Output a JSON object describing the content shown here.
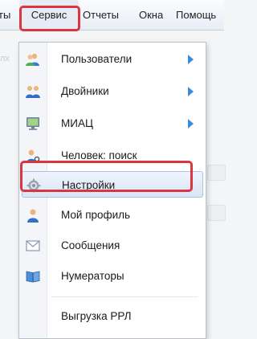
{
  "menubar": {
    "prev_cut": "ты",
    "service": "Сервис",
    "reports": "Отчеты",
    "windows": "Окна",
    "help": "Помощь"
  },
  "background": {
    "left_hint": "лх"
  },
  "menu": {
    "items": [
      {
        "label": "Пользователи",
        "icon": "users-icon",
        "submenu": true
      },
      {
        "label": "Двойники",
        "icon": "duplicates-icon",
        "submenu": true
      },
      {
        "label": "МИАЦ",
        "icon": "monitor-icon",
        "submenu": true
      },
      {
        "label": "Человек: поиск",
        "icon": "person-search-icon",
        "submenu": false
      },
      {
        "label": "Настройки",
        "icon": "gear-icon",
        "submenu": false,
        "highlighted": true
      },
      {
        "label": "Мой профиль",
        "icon": "profile-icon",
        "submenu": false
      },
      {
        "label": "Сообщения",
        "icon": "envelope-icon",
        "submenu": false
      },
      {
        "label": "Нумераторы",
        "icon": "book-icon",
        "submenu": false
      },
      {
        "label": "Выгрузка РРЛ",
        "icon": "",
        "submenu": false
      }
    ]
  },
  "colors": {
    "highlight_frame": "#d9363e",
    "submenu_arrow": "#3d8be0"
  }
}
